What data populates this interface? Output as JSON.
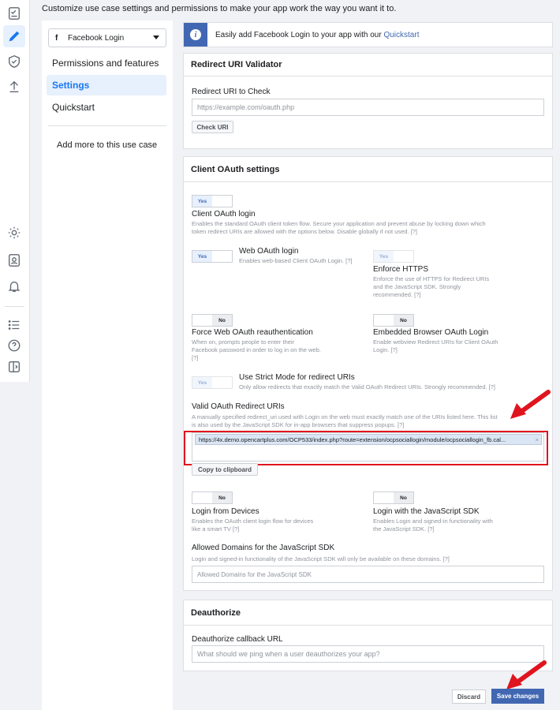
{
  "page": {
    "description": "Customize use case settings and permissions to make your app work the way you want it to."
  },
  "rail": {
    "icons": [
      "checklist-icon",
      "pencil-icon",
      "shield-check-icon",
      "upload-icon",
      "gear-icon",
      "contact-card-icon",
      "bell-icon",
      "list-icon",
      "help-icon",
      "panel-toggle-icon"
    ],
    "accent": "#1877f2"
  },
  "nav": {
    "product": {
      "icon": "f",
      "label": "Facebook Login"
    },
    "items": [
      {
        "label": "Permissions and features"
      },
      {
        "label": "Settings"
      },
      {
        "label": "Quickstart"
      }
    ],
    "add_more": "Add more to this use case"
  },
  "banner": {
    "text": "Easily add Facebook Login to your app with our",
    "link": "Quickstart"
  },
  "redirect_validator": {
    "title": "Redirect URI Validator",
    "field_label": "Redirect URI to Check",
    "placeholder": "https://example.com/oauth.php",
    "button": "Check URI"
  },
  "client_oauth": {
    "title": "Client OAuth settings",
    "client_oauth_login": {
      "toggle": "Yes",
      "label": "Client OAuth login",
      "desc": "Enables the standard OAuth client token flow. Secure your application and prevent abuse by locking down which token redirect URIs are allowed with the options below. Disable globally if not used.",
      "help": "[?]"
    },
    "web_oauth_login": {
      "toggle": "Yes",
      "label": "Web OAuth login",
      "desc": "Enables web-based Client OAuth Login.",
      "help": "[?]"
    },
    "enforce_https": {
      "toggle": "Yes",
      "label": "Enforce HTTPS",
      "desc": "Enforce the use of HTTPS for Redirect URIs and the JavaScript SDK. Strongly recommended.",
      "help": "[?]"
    },
    "force_reauth": {
      "toggle": "No",
      "label": "Force Web OAuth reauthentication",
      "desc": "When on, prompts people to enter their Facebook password in order to log in on the web.",
      "help": "[?]"
    },
    "embedded_browser": {
      "toggle": "No",
      "label": "Embedded Browser OAuth Login",
      "desc": "Enable webview Redirect URIs for Client OAuth Login.",
      "help": "[?]"
    },
    "strict_mode": {
      "toggle": "Yes",
      "label": "Use Strict Mode for redirect URIs",
      "desc": "Only allow redirects that exactly match the Valid OAuth Redirect URIs. Strongly recommended.",
      "help": "[?]"
    },
    "valid_uris": {
      "label": "Valid OAuth Redirect URIs",
      "desc": "A manually specified redirect_uri used with Login on the web must exactly match one of the URIs listed here. This list is also used by the JavaScript SDK for in-app browsers that suppress popups.",
      "help": "[?]",
      "uri": "https://4x.demo.opencartplus.com/OCP533/index.php?route=extension/ocpsociallogin/module/ocpsociallogin_fb.cal...",
      "remove": "×",
      "copy_button": "Copy to clipboard"
    },
    "login_devices": {
      "toggle": "No",
      "label": "Login from Devices",
      "desc": "Enables the OAuth client login flow for devices like a smart TV",
      "help": "[?]"
    },
    "login_js_sdk": {
      "toggle": "No",
      "label": "Login with the JavaScript SDK",
      "desc": "Enables Login and signed-in functionality with the JavaScript SDK.",
      "help": "[?]"
    },
    "allowed_domains": {
      "label": "Allowed Domains for the JavaScript SDK",
      "desc": "Login and signed-in functionality of the JavaScript SDK will only be available on these domains.",
      "help": "[?]",
      "placeholder": "Allowed Domains for the JavaScript SDK"
    }
  },
  "deauthorize": {
    "title": "Deauthorize",
    "field_label": "Deauthorize callback URL",
    "placeholder": "What should we ping when a user deauthorizes your app?"
  },
  "footer": {
    "discard": "Discard",
    "save": "Save changes"
  },
  "colors": {
    "annotation_red": "#e0141e",
    "primary": "#4267b2"
  }
}
